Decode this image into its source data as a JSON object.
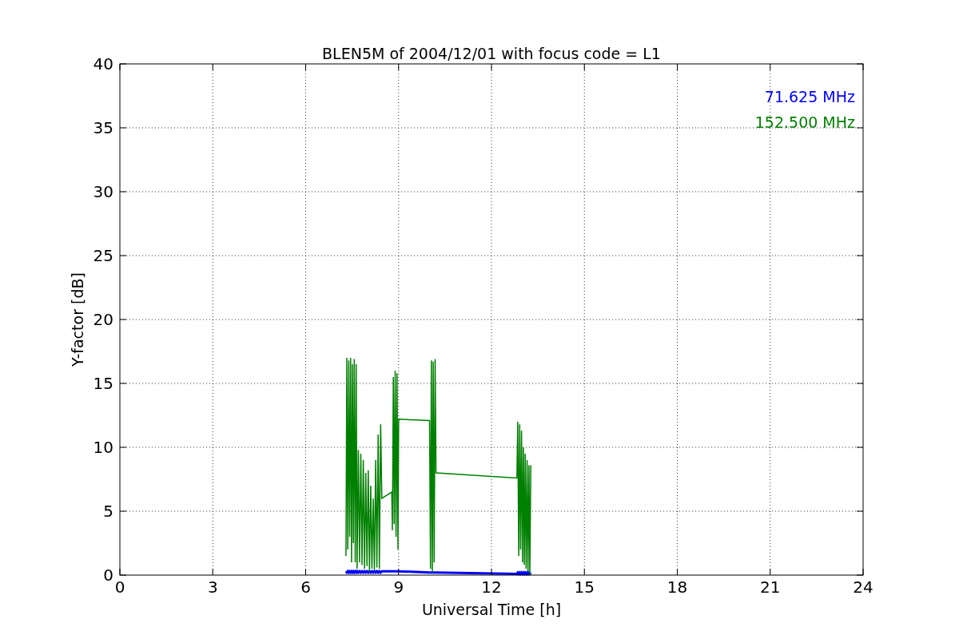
{
  "chart_data": {
    "type": "line",
    "title": "BLEN5M of 2004/12/01 with focus code = L1",
    "xlabel": "Universal Time [h]",
    "ylabel": "Y-factor [dB]",
    "xlim": [
      0,
      24
    ],
    "ylim": [
      0,
      40
    ],
    "grid": true,
    "xticks": [
      0,
      3,
      6,
      9,
      12,
      15,
      18,
      21,
      24
    ],
    "yticks": [
      0,
      5,
      10,
      15,
      20,
      25,
      30,
      35,
      40
    ],
    "x": [
      7.3,
      7.33,
      7.36,
      7.39,
      7.42,
      7.45,
      7.48,
      7.51,
      7.54,
      7.57,
      7.6,
      7.63,
      7.66,
      7.7,
      7.74,
      7.78,
      7.82,
      7.86,
      7.9,
      7.94,
      7.98,
      8.02,
      8.06,
      8.1,
      8.14,
      8.18,
      8.22,
      8.26,
      8.3,
      8.34,
      8.38,
      8.42,
      8.46,
      8.78,
      8.8,
      8.83,
      8.86,
      8.89,
      8.92,
      8.95,
      8.98,
      9.0,
      10.0,
      10.03,
      10.06,
      10.09,
      10.12,
      10.15,
      10.18,
      10.21,
      12.82,
      12.85,
      12.88,
      12.91,
      12.94,
      12.97,
      13.0,
      13.03,
      13.06,
      13.09,
      13.12,
      13.15,
      13.18,
      13.21,
      13.24,
      13.27
    ],
    "series": [
      {
        "name": "71.625 MHz",
        "color": "#0000ff",
        "values": [
          0.3,
          0.2,
          0.3,
          0.2,
          0.3,
          0.2,
          0.3,
          0.2,
          0.3,
          0.2,
          0.3,
          0.2,
          0.3,
          0.2,
          0.3,
          0.2,
          0.3,
          0.2,
          0.3,
          0.2,
          0.3,
          0.2,
          0.3,
          0.2,
          0.3,
          0.2,
          0.3,
          0.2,
          0.3,
          0.2,
          0.3,
          0.2,
          0.3,
          0.3,
          0.3,
          0.3,
          0.3,
          0.3,
          0.3,
          0.3,
          0.3,
          0.3,
          0.2,
          0.2,
          0.2,
          0.2,
          0.2,
          0.2,
          0.2,
          0.2,
          0.1,
          0.2,
          0.1,
          0.2,
          0.1,
          0.2,
          0.1,
          0.2,
          0.1,
          0.2,
          0.1,
          0.2,
          0.1,
          0.2,
          0.1,
          0.2
        ]
      },
      {
        "name": "152.500 MHz",
        "color": "#008000",
        "values": [
          1.5,
          17,
          2,
          16.8,
          3,
          17,
          1,
          16.5,
          2.5,
          16.9,
          1,
          16.5,
          0.5,
          9.8,
          1,
          9.5,
          0.8,
          9,
          0.5,
          8,
          0.7,
          8.2,
          0.3,
          7,
          0.5,
          6,
          0.4,
          9,
          0.6,
          11,
          0.5,
          11.8,
          6,
          6.5,
          3.5,
          15.5,
          4,
          16,
          3,
          15.8,
          2,
          12.2,
          12.1,
          0.5,
          16.8,
          0.2,
          16.7,
          1,
          16.9,
          8.0,
          7.6,
          12,
          1.5,
          11.8,
          2,
          11.3,
          1,
          10,
          0.8,
          9.5,
          0.5,
          9,
          0.3,
          8.6,
          0,
          8.6
        ]
      }
    ]
  }
}
